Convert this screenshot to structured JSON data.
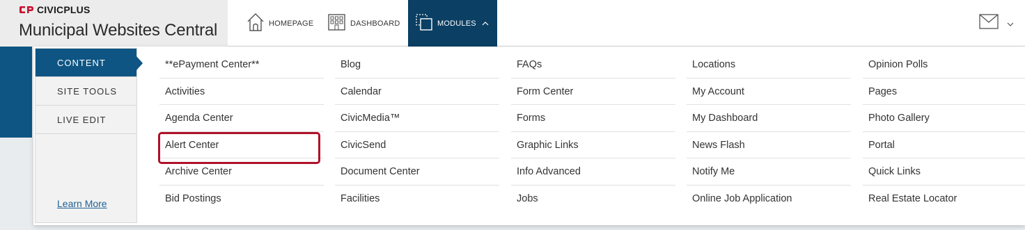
{
  "brand": {
    "logo_text": "CIVICPLUS",
    "title": "Municipal Websites Central"
  },
  "nav": {
    "items": [
      {
        "label": "HOMEPAGE",
        "icon": "house-icon"
      },
      {
        "label": "DASHBOARD",
        "icon": "building-icon"
      },
      {
        "label": "MODULES",
        "icon": "modules-icon",
        "active": true
      }
    ]
  },
  "header_right": {
    "mail_icon": "envelope-icon",
    "dropdown_icon": "chevron-down-icon"
  },
  "sidebar": {
    "items": [
      {
        "label": "CONTENT",
        "active": true
      },
      {
        "label": "SITE TOOLS"
      },
      {
        "label": "LIVE EDIT"
      }
    ],
    "learn_more": "Learn More"
  },
  "modules": {
    "columns": [
      [
        "**ePayment Center**",
        "Activities",
        "Agenda Center",
        "Alert Center",
        "Archive Center",
        "Bid Postings"
      ],
      [
        "Blog",
        "Calendar",
        "CivicMedia™",
        "CivicSend",
        "Document Center",
        "Facilities"
      ],
      [
        "FAQs",
        "Form Center",
        "Forms",
        "Graphic Links",
        "Info Advanced",
        "Jobs"
      ],
      [
        "Locations",
        "My Account",
        "My Dashboard",
        "News Flash",
        "Notify Me",
        "Online Job Application"
      ],
      [
        "Opinion Polls",
        "Pages",
        "Photo Gallery",
        "Portal",
        "Quick Links",
        "Real Estate Locator"
      ]
    ],
    "highlighted": "Alert Center"
  },
  "colors": {
    "nav_active": "#0b3f63",
    "sidebar_active": "#0e5583",
    "highlight_border": "#b0102b",
    "brand_red": "#c8102e"
  }
}
